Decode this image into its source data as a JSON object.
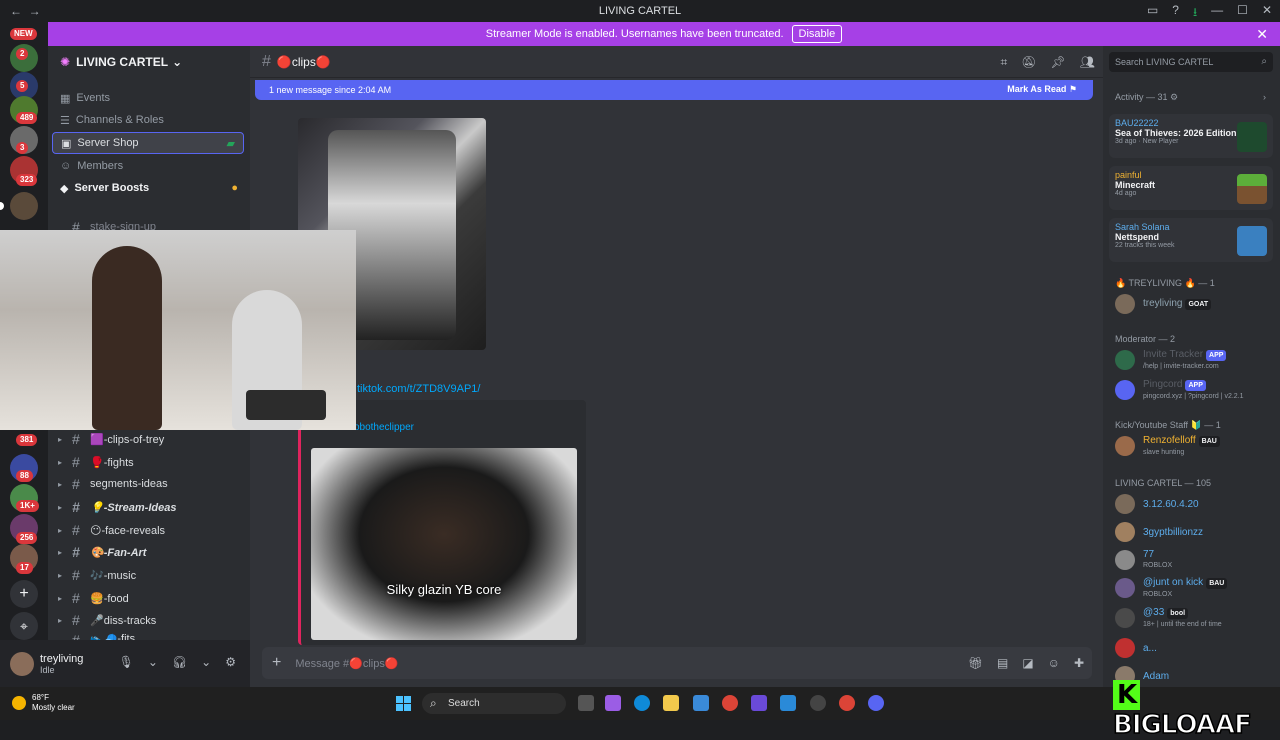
{
  "window": {
    "title": "LIVING CARTEL",
    "back": "←",
    "forward": "→"
  },
  "banner": {
    "text": "Streamer Mode is enabled. Usernames have been truncated.",
    "button": "Disable",
    "close": "✕"
  },
  "guilds": {
    "new_label": "NEW",
    "badges": [
      "2",
      "5",
      "489",
      "3",
      "323",
      "381",
      "88",
      "1K+",
      "256",
      "17"
    ],
    "add": "+",
    "discover": "⌖"
  },
  "server": {
    "name": "LIVING CARTEL",
    "items": [
      {
        "label": "Events",
        "icon": "calendar-icon"
      },
      {
        "label": "Channels & Roles",
        "icon": "channels-icon"
      },
      {
        "label": "Server Shop",
        "icon": "shop-icon"
      },
      {
        "label": "Members",
        "icon": "members-icon"
      },
      {
        "label": "Server Boosts",
        "icon": "boost-icon"
      }
    ],
    "channels": [
      "stake-sign-up",
      "🟪-clips-of-trey",
      "🥊-fights",
      "segments-ideas",
      "💡-Stream-Ideas",
      "😶-face-reveals",
      "🎨-Fan-Art",
      "🎶-music",
      "🍔-food",
      "🎤diss-tracks",
      "👟🧢-fits"
    ]
  },
  "user": {
    "name": "treyliving",
    "status": "Idle"
  },
  "chat": {
    "channel_name": "🔴clips🔴",
    "new_messages": "1 new message since 2:04 AM",
    "mark_read": "Mark As Read",
    "link": "tiktok.com/t/ZTD8V9AP1/",
    "embed_provider": "TikTok - bobotheclipper",
    "video_caption": "Silky glazin YB core",
    "composer_placeholder": "Message #🔴clips🔴"
  },
  "members": {
    "search_placeholder": "Search LIVING CARTEL",
    "activity_header": "Activity — 31",
    "activities": [
      {
        "user": "BAU22222",
        "game": "Sea of Thieves: 2026 Edition",
        "meta": "3d ago · New Player"
      },
      {
        "user": "painful",
        "game": "Minecraft",
        "meta": "4d ago"
      },
      {
        "user": "Sarah Solana",
        "game": "Nettspend",
        "meta": "22 tracks this week"
      }
    ],
    "groups": [
      {
        "header": "🔥 TREYLIVING 🔥 — 1",
        "members": [
          {
            "name": "treyliving",
            "tag": "GOAT",
            "sub": ""
          }
        ]
      },
      {
        "header": "Moderator — 2",
        "members": [
          {
            "name": "Invite Tracker",
            "tag": "APP",
            "sub": "/help | invite-tracker.com"
          },
          {
            "name": "Pingcord",
            "tag": "APP",
            "sub": "pingcord.xyz | ?pingcord | v2.2.1"
          }
        ]
      },
      {
        "header": "Kick/Youtube Staff 🔰 — 1",
        "members": [
          {
            "name": "Renzofelloff",
            "tag": "BAU",
            "sub": "slave hunting"
          }
        ]
      },
      {
        "header": "LIVING CARTEL — 105",
        "members": [
          {
            "name": "3.12.60.4.20",
            "tag": "",
            "sub": ""
          },
          {
            "name": "3gyptbillionzz",
            "tag": "",
            "sub": ""
          },
          {
            "name": "77",
            "tag": "",
            "sub": "ROBLOX"
          },
          {
            "name": "@junt on kick",
            "tag": "BAU",
            "sub": "ROBLOX"
          },
          {
            "name": "@33",
            "tag": "bool",
            "sub": "18+ | until the end of time"
          },
          {
            "name": "a...",
            "tag": "",
            "sub": ""
          },
          {
            "name": "Adam",
            "tag": "",
            "sub": ""
          }
        ]
      }
    ]
  },
  "taskbar": {
    "weather_temp": "68°F",
    "weather_desc": "Mostly clear",
    "search_label": "Search"
  },
  "watermark": {
    "k": "K",
    "text": "BIGLOAAF"
  },
  "colors": {
    "blurple": "#5865f2",
    "banner": "#a640e6",
    "link": "#00a8fc",
    "kick_green": "#53fc18"
  }
}
